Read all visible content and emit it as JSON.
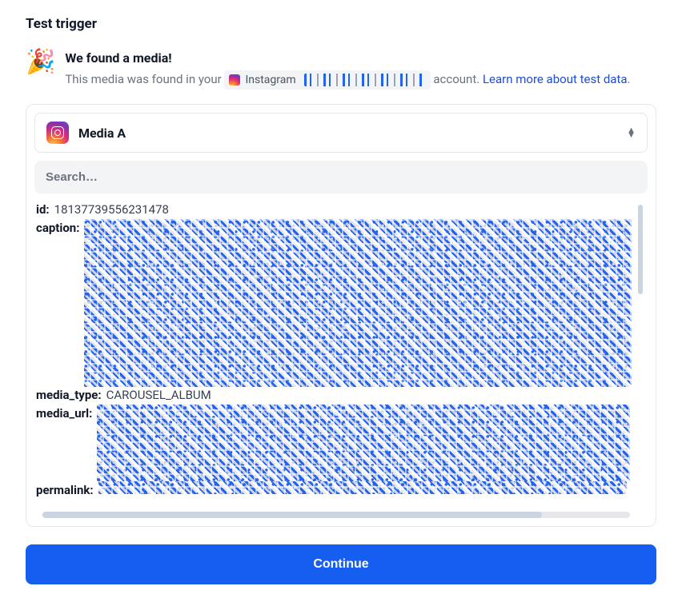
{
  "section_title": "Test trigger",
  "found": {
    "heading": "We found a media!",
    "prefix_text": "This media was found in your",
    "app_name": "Instagram",
    "account_redacted": true,
    "suffix_text": "account.",
    "learn_more": "Learn more about test data"
  },
  "selector": {
    "label": "Media A"
  },
  "search": {
    "placeholder": "Search…"
  },
  "fields": {
    "id": {
      "label": "id:",
      "value": "18137739556231478"
    },
    "caption": {
      "label": "caption:",
      "redacted": true
    },
    "media_type": {
      "label": "media_type:",
      "value": "CAROUSEL_ALBUM"
    },
    "media_url": {
      "label": "media_url:",
      "redacted": true
    },
    "permalink": {
      "label": "permalink:",
      "redacted": true
    }
  },
  "continue_label": "Continue"
}
